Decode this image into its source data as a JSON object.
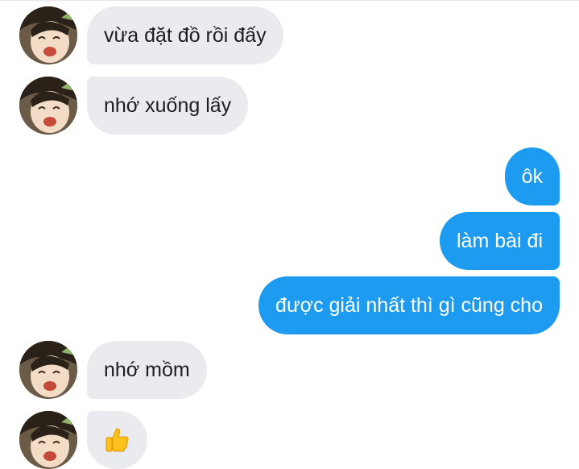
{
  "colors": {
    "incoming_bubble": "#e9ebef",
    "outgoing_bubble": "#1d9bf0",
    "incoming_text": "#1c1e21",
    "outgoing_text": "#ffffff"
  },
  "messages": [
    {
      "sender": "contact",
      "text": "vừa đặt đồ rồi đấy"
    },
    {
      "sender": "contact",
      "text": "nhớ xuống lấy"
    },
    {
      "sender": "me",
      "text": "ôk"
    },
    {
      "sender": "me",
      "text": "làm bài đi"
    },
    {
      "sender": "me",
      "text": "được giải nhất thì gì cũng cho"
    },
    {
      "sender": "contact",
      "text": "nhớ mồm"
    },
    {
      "sender": "contact",
      "icon": "thumbs-up-icon"
    }
  ]
}
